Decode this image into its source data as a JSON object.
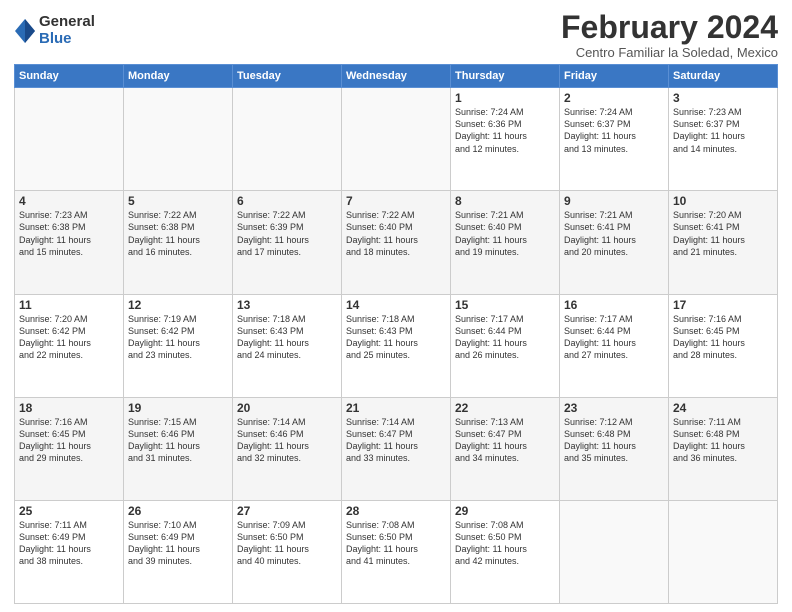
{
  "header": {
    "logo_general": "General",
    "logo_blue": "Blue",
    "month_title": "February 2024",
    "subtitle": "Centro Familiar la Soledad, Mexico"
  },
  "weekdays": [
    "Sunday",
    "Monday",
    "Tuesday",
    "Wednesday",
    "Thursday",
    "Friday",
    "Saturday"
  ],
  "weeks": [
    [
      {
        "day": "",
        "info": ""
      },
      {
        "day": "",
        "info": ""
      },
      {
        "day": "",
        "info": ""
      },
      {
        "day": "",
        "info": ""
      },
      {
        "day": "1",
        "info": "Sunrise: 7:24 AM\nSunset: 6:36 PM\nDaylight: 11 hours\nand 12 minutes."
      },
      {
        "day": "2",
        "info": "Sunrise: 7:24 AM\nSunset: 6:37 PM\nDaylight: 11 hours\nand 13 minutes."
      },
      {
        "day": "3",
        "info": "Sunrise: 7:23 AM\nSunset: 6:37 PM\nDaylight: 11 hours\nand 14 minutes."
      }
    ],
    [
      {
        "day": "4",
        "info": "Sunrise: 7:23 AM\nSunset: 6:38 PM\nDaylight: 11 hours\nand 15 minutes."
      },
      {
        "day": "5",
        "info": "Sunrise: 7:22 AM\nSunset: 6:38 PM\nDaylight: 11 hours\nand 16 minutes."
      },
      {
        "day": "6",
        "info": "Sunrise: 7:22 AM\nSunset: 6:39 PM\nDaylight: 11 hours\nand 17 minutes."
      },
      {
        "day": "7",
        "info": "Sunrise: 7:22 AM\nSunset: 6:40 PM\nDaylight: 11 hours\nand 18 minutes."
      },
      {
        "day": "8",
        "info": "Sunrise: 7:21 AM\nSunset: 6:40 PM\nDaylight: 11 hours\nand 19 minutes."
      },
      {
        "day": "9",
        "info": "Sunrise: 7:21 AM\nSunset: 6:41 PM\nDaylight: 11 hours\nand 20 minutes."
      },
      {
        "day": "10",
        "info": "Sunrise: 7:20 AM\nSunset: 6:41 PM\nDaylight: 11 hours\nand 21 minutes."
      }
    ],
    [
      {
        "day": "11",
        "info": "Sunrise: 7:20 AM\nSunset: 6:42 PM\nDaylight: 11 hours\nand 22 minutes."
      },
      {
        "day": "12",
        "info": "Sunrise: 7:19 AM\nSunset: 6:42 PM\nDaylight: 11 hours\nand 23 minutes."
      },
      {
        "day": "13",
        "info": "Sunrise: 7:18 AM\nSunset: 6:43 PM\nDaylight: 11 hours\nand 24 minutes."
      },
      {
        "day": "14",
        "info": "Sunrise: 7:18 AM\nSunset: 6:43 PM\nDaylight: 11 hours\nand 25 minutes."
      },
      {
        "day": "15",
        "info": "Sunrise: 7:17 AM\nSunset: 6:44 PM\nDaylight: 11 hours\nand 26 minutes."
      },
      {
        "day": "16",
        "info": "Sunrise: 7:17 AM\nSunset: 6:44 PM\nDaylight: 11 hours\nand 27 minutes."
      },
      {
        "day": "17",
        "info": "Sunrise: 7:16 AM\nSunset: 6:45 PM\nDaylight: 11 hours\nand 28 minutes."
      }
    ],
    [
      {
        "day": "18",
        "info": "Sunrise: 7:16 AM\nSunset: 6:45 PM\nDaylight: 11 hours\nand 29 minutes."
      },
      {
        "day": "19",
        "info": "Sunrise: 7:15 AM\nSunset: 6:46 PM\nDaylight: 11 hours\nand 31 minutes."
      },
      {
        "day": "20",
        "info": "Sunrise: 7:14 AM\nSunset: 6:46 PM\nDaylight: 11 hours\nand 32 minutes."
      },
      {
        "day": "21",
        "info": "Sunrise: 7:14 AM\nSunset: 6:47 PM\nDaylight: 11 hours\nand 33 minutes."
      },
      {
        "day": "22",
        "info": "Sunrise: 7:13 AM\nSunset: 6:47 PM\nDaylight: 11 hours\nand 34 minutes."
      },
      {
        "day": "23",
        "info": "Sunrise: 7:12 AM\nSunset: 6:48 PM\nDaylight: 11 hours\nand 35 minutes."
      },
      {
        "day": "24",
        "info": "Sunrise: 7:11 AM\nSunset: 6:48 PM\nDaylight: 11 hours\nand 36 minutes."
      }
    ],
    [
      {
        "day": "25",
        "info": "Sunrise: 7:11 AM\nSunset: 6:49 PM\nDaylight: 11 hours\nand 38 minutes."
      },
      {
        "day": "26",
        "info": "Sunrise: 7:10 AM\nSunset: 6:49 PM\nDaylight: 11 hours\nand 39 minutes."
      },
      {
        "day": "27",
        "info": "Sunrise: 7:09 AM\nSunset: 6:50 PM\nDaylight: 11 hours\nand 40 minutes."
      },
      {
        "day": "28",
        "info": "Sunrise: 7:08 AM\nSunset: 6:50 PM\nDaylight: 11 hours\nand 41 minutes."
      },
      {
        "day": "29",
        "info": "Sunrise: 7:08 AM\nSunset: 6:50 PM\nDaylight: 11 hours\nand 42 minutes."
      },
      {
        "day": "",
        "info": ""
      },
      {
        "day": "",
        "info": ""
      }
    ]
  ]
}
